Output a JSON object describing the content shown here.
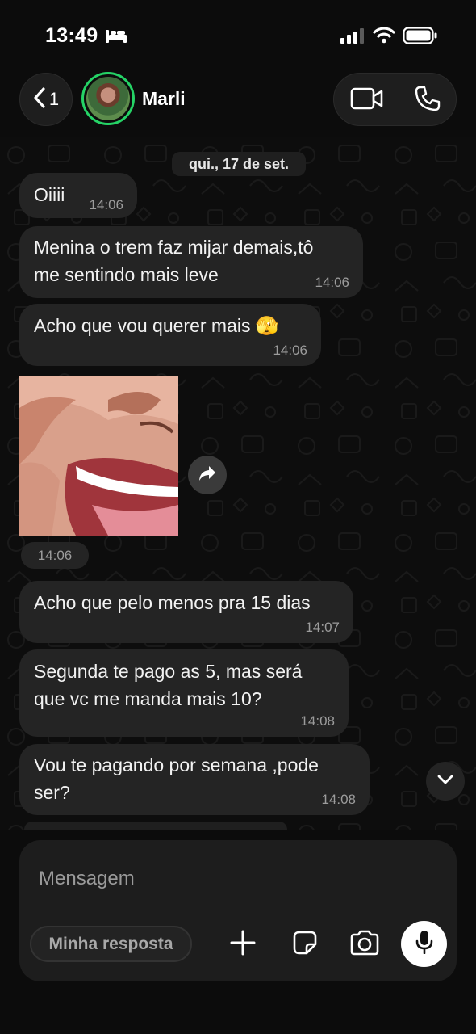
{
  "status_bar": {
    "time": "13:49",
    "icons": [
      "bed-icon",
      "signal-icon",
      "wifi-icon",
      "battery-icon"
    ]
  },
  "header": {
    "back_count": "1",
    "contact_name": "Marli",
    "avatar_ring_color": "#25d366",
    "icons": [
      "chevron-left-icon",
      "video-camera-icon",
      "phone-icon"
    ]
  },
  "chat": {
    "date_label": "qui., 17 de set.",
    "messages": [
      {
        "type": "text",
        "text": "Oiiii",
        "time": "14:06"
      },
      {
        "type": "text",
        "lines": [
          "Menina o trem faz mijar demais,tô",
          "me sentindo mais leve"
        ],
        "time": "14:06"
      },
      {
        "type": "text",
        "text": "Acho que vou querer mais 🫣",
        "time": "14:06"
      },
      {
        "type": "image",
        "time": "14:06",
        "icons": [
          "forward-arrow-icon"
        ]
      },
      {
        "type": "text",
        "text": "Acho que pelo menos pra 15 dias",
        "time": "14:07"
      },
      {
        "type": "text",
        "lines": [
          "Segunda te pago as 5, mas será",
          "que vc me manda mais 10?"
        ],
        "time": "14:08"
      },
      {
        "type": "text",
        "lines": [
          "Vou te pagando por semana ,pode",
          "ser?"
        ],
        "time": "14:08"
      }
    ],
    "scroll_icon": "chevron-down-icon"
  },
  "composer": {
    "placeholder": "Mensagem",
    "quick_reply_label": "Minha resposta",
    "icons": [
      "plus-icon",
      "sticker-icon",
      "camera-icon",
      "microphone-icon"
    ]
  },
  "colors": {
    "background": "#0c0c0c",
    "bubble": "#242424",
    "accent_green": "#25d366",
    "timestamp": "#9c9c9c"
  }
}
